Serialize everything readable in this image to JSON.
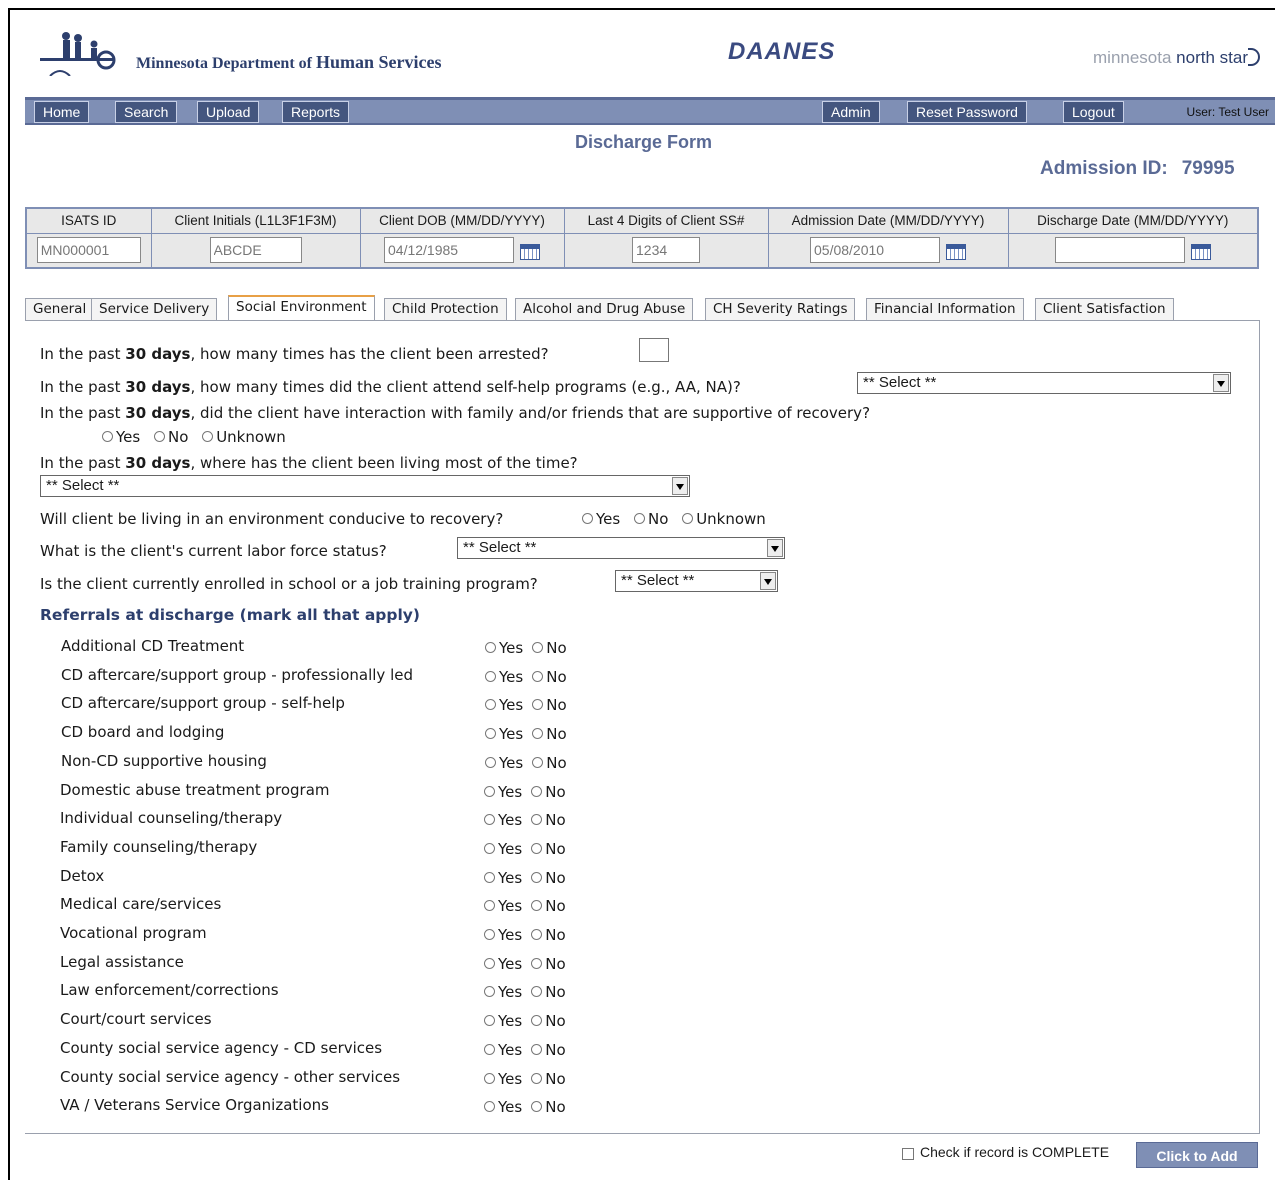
{
  "header": {
    "org_prefix": "Minnesota Department of",
    "org_name": "Human Services",
    "app_title": "DAANES",
    "brand_a": "minnesota",
    "brand_b": "north",
    "brand_c": "star"
  },
  "nav": {
    "home": "Home",
    "search": "Search",
    "upload": "Upload",
    "reports": "Reports",
    "admin": "Admin",
    "reset_password": "Reset Password",
    "logout": "Logout",
    "user_label": "User: Test User"
  },
  "page": {
    "title": "Discharge Form",
    "admission_id_label": "Admission ID:",
    "admission_id_value": "79995"
  },
  "id_table": {
    "headers": [
      "ISATS ID",
      "Client Initials (L1L3F1F3M)",
      "Client DOB (MM/DD/YYYY)",
      "Last 4 Digits of Client SS#",
      "Admission Date (MM/DD/YYYY)",
      "Discharge Date (MM/DD/YYYY)"
    ],
    "isats_id": "MN000001",
    "initials": "ABCDE",
    "dob": "04/12/1985",
    "ssn4": "1234",
    "admission_date": "05/08/2010",
    "discharge_date": ""
  },
  "tabs": [
    "General",
    "Service Delivery",
    "Social Environment",
    "Child Protection",
    "Alcohol and Drug Abuse",
    "CH Severity Ratings",
    "Financial Information",
    "Client Satisfaction"
  ],
  "active_tab": "Social Environment",
  "questions": {
    "prefix": "In the past",
    "days": "30 days",
    "arrested": ", how many times has the client been arrested?",
    "selfhelp": ", how many times did the client attend self-help programs (e.g., AA, NA)?",
    "family": ", did the client have interaction with family and/or friends that are supportive of recovery?",
    "living": ", where has the client been living most of the time?",
    "environment": "Will client be living in an environment conducive to recovery?",
    "labor": "What is the client's current labor force status?",
    "school": "Is the client currently enrolled in school or a job training program?"
  },
  "options": {
    "yes": "Yes",
    "no": "No",
    "unknown": "Unknown",
    "select": "** Select **"
  },
  "referrals": {
    "title": "Referrals at discharge (mark all that apply)",
    "items": [
      "Additional CD Treatment",
      "CD aftercare/support group - professionally led",
      "CD aftercare/support group - self-help",
      "CD board and lodging",
      "Non-CD supportive housing",
      "Domestic abuse treatment program",
      "Individual counseling/therapy",
      "Family counseling/therapy",
      "Detox",
      "Medical care/services",
      "Vocational program",
      "Legal assistance",
      "Law enforcement/corrections",
      "Court/court services",
      "County social service agency - CD services",
      "County social service agency - other services",
      "VA / Veterans Service Organizations"
    ]
  },
  "footer": {
    "complete_label": "Check if record is COMPLETE",
    "add_button": "Click to Add"
  }
}
